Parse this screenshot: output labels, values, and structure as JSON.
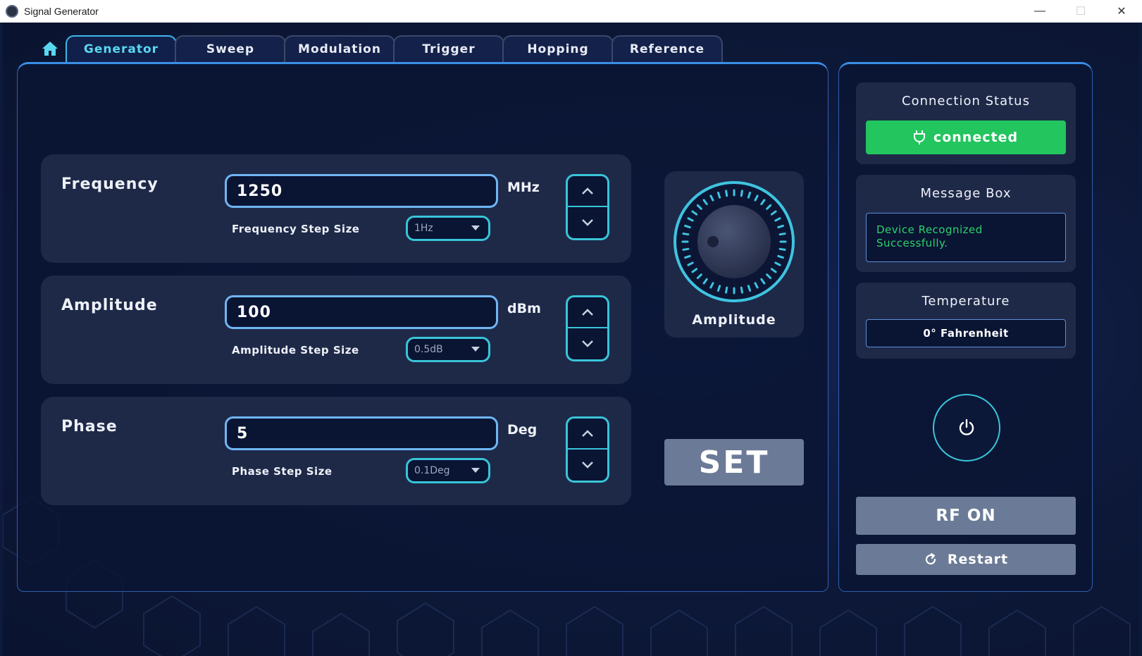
{
  "window": {
    "title": "Signal Generator"
  },
  "tabs": [
    {
      "label": "Generator",
      "active": true
    },
    {
      "label": "Sweep"
    },
    {
      "label": "Modulation"
    },
    {
      "label": "Trigger"
    },
    {
      "label": "Hopping"
    },
    {
      "label": "Reference"
    }
  ],
  "params": {
    "frequency": {
      "title": "Frequency",
      "value": "1250",
      "unit": "MHz",
      "step_label": "Frequency Step Size",
      "step_value": "1Hz"
    },
    "amplitude": {
      "title": "Amplitude",
      "value": "100",
      "unit": "dBm",
      "step_label": "Amplitude Step Size",
      "step_value": "0.5dB"
    },
    "phase": {
      "title": "Phase",
      "value": "5",
      "unit": "Deg",
      "step_label": "Phase Step Size",
      "step_value": "0.1Deg"
    }
  },
  "knob": {
    "label": "Amplitude"
  },
  "set_button": "SET",
  "side": {
    "connection": {
      "title": "Connection Status",
      "status": "connected"
    },
    "message": {
      "title": "Message Box",
      "text": "Device Recognized Successfully."
    },
    "temperature": {
      "title": "Temperature",
      "value": "0° Fahrenheit"
    },
    "rf_button": "RF ON",
    "restart_button": "Restart"
  },
  "colors": {
    "accent": "#39c4d8",
    "active_tab": "#58d8f0",
    "connected": "#22c55e",
    "message_text": "#2bd36c",
    "panel_bg": "#1e2948",
    "button_gray": "#6b7a96"
  },
  "icons": {
    "home": "home-icon",
    "plug": "plug-icon",
    "power": "power-icon",
    "restart": "restart-icon",
    "up": "chevron-up-icon",
    "down": "chevron-down-icon"
  }
}
